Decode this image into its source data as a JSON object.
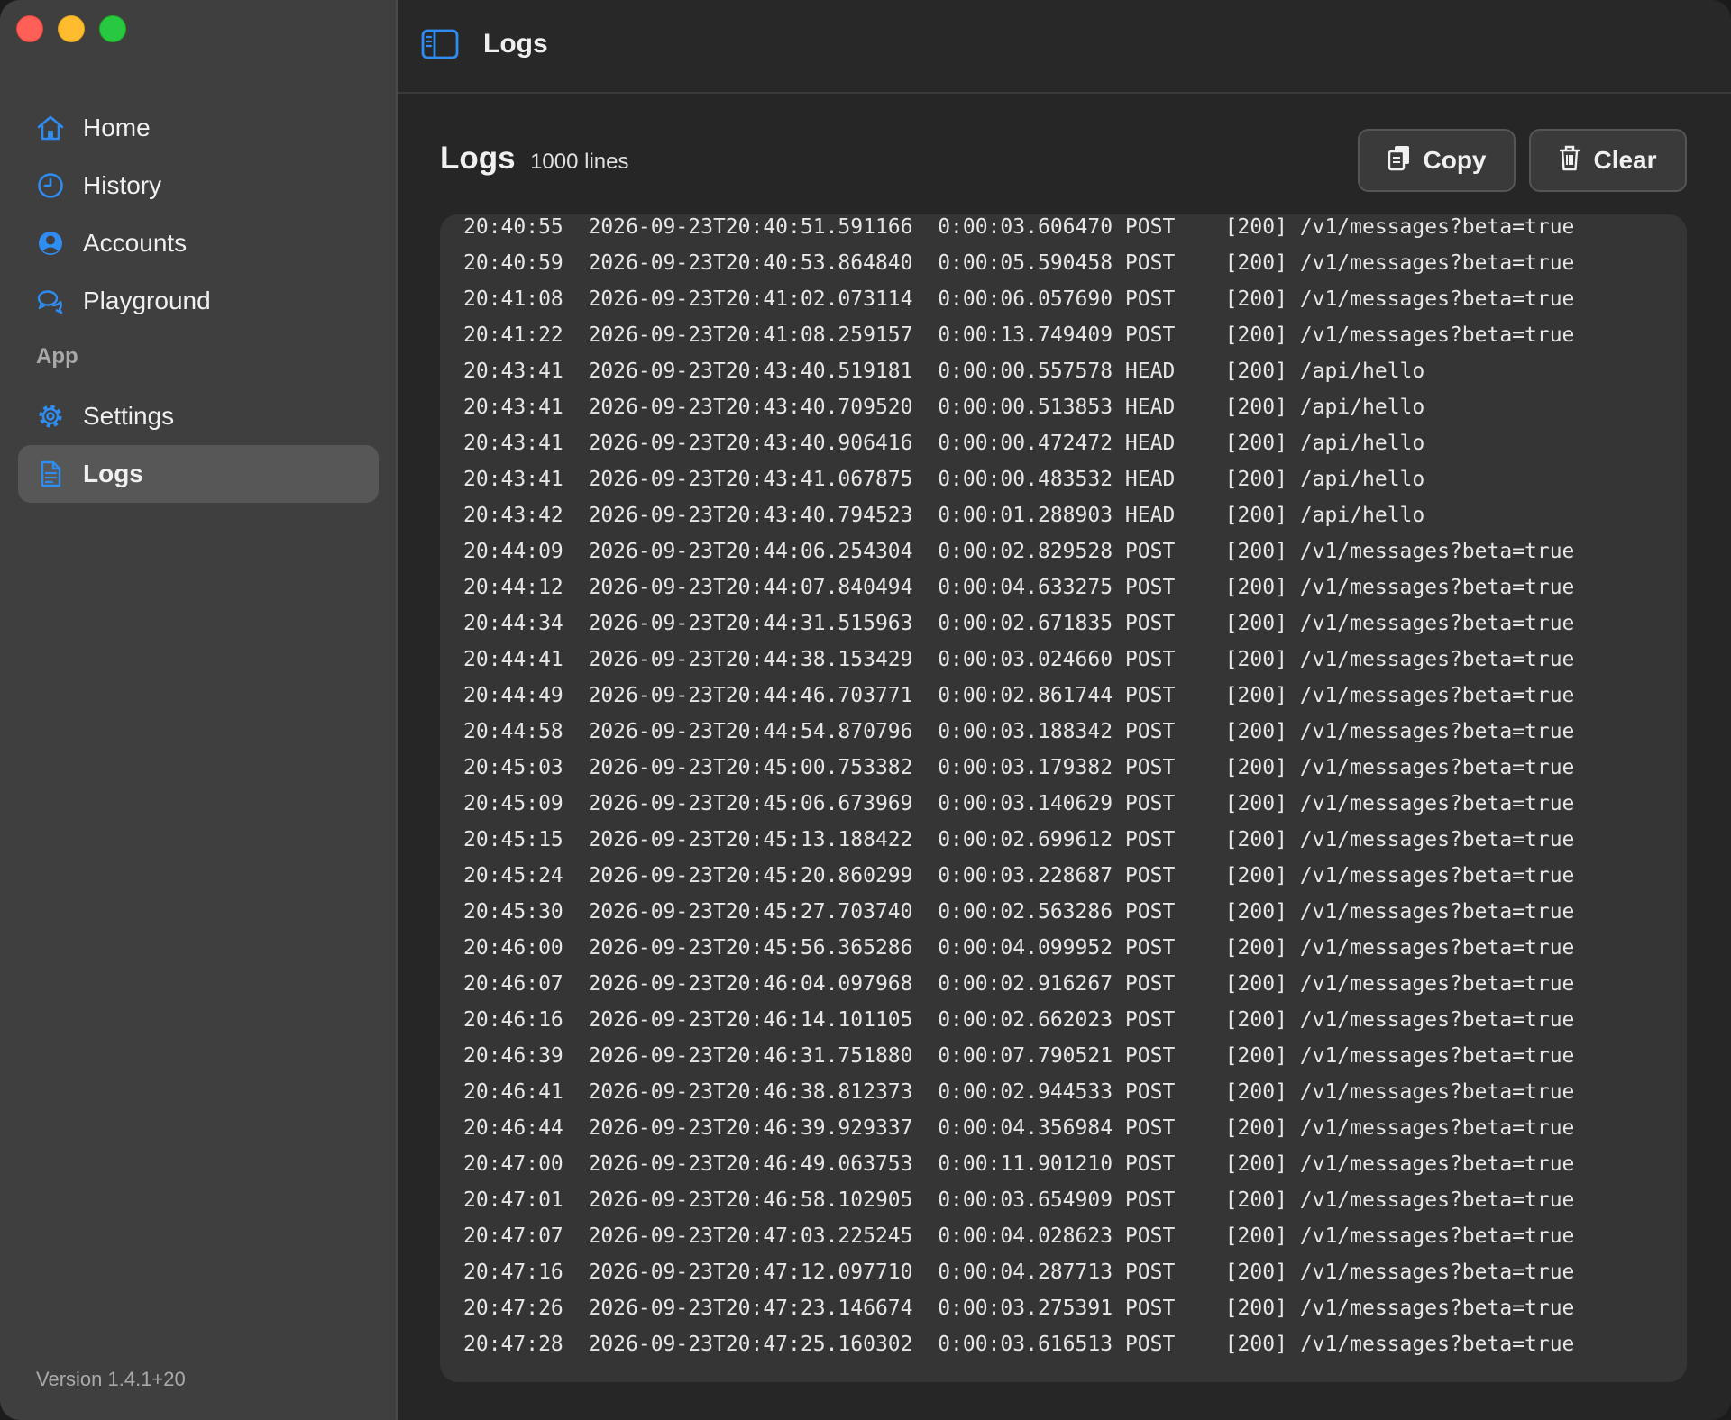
{
  "window": {
    "controls": [
      "close",
      "minimize",
      "zoom"
    ]
  },
  "sidebar": {
    "items": [
      {
        "label": "Home",
        "icon": "house-icon"
      },
      {
        "label": "History",
        "icon": "clock-icon"
      },
      {
        "label": "Accounts",
        "icon": "person-circle-icon"
      },
      {
        "label": "Playground",
        "icon": "chat-bubbles-icon"
      }
    ],
    "section_label": "App",
    "app_items": [
      {
        "label": "Settings",
        "icon": "gear-icon"
      },
      {
        "label": "Logs",
        "icon": "document-icon",
        "active": true
      }
    ],
    "version": "Version 1.4.1+20"
  },
  "toolbar": {
    "title": "Logs"
  },
  "logs": {
    "title": "Logs",
    "count": "1000 lines",
    "copy_label": "Copy",
    "clear_label": "Clear",
    "lines": [
      "20:40:55  2026-09-23T20:40:51.591166  0:00:03.606470 POST    [200] /v1/messages?beta=true",
      "20:40:59  2026-09-23T20:40:53.864840  0:00:05.590458 POST    [200] /v1/messages?beta=true",
      "20:41:08  2026-09-23T20:41:02.073114  0:00:06.057690 POST    [200] /v1/messages?beta=true",
      "20:41:22  2026-09-23T20:41:08.259157  0:00:13.749409 POST    [200] /v1/messages?beta=true",
      "20:43:41  2026-09-23T20:43:40.519181  0:00:00.557578 HEAD    [200] /api/hello",
      "20:43:41  2026-09-23T20:43:40.709520  0:00:00.513853 HEAD    [200] /api/hello",
      "20:43:41  2026-09-23T20:43:40.906416  0:00:00.472472 HEAD    [200] /api/hello",
      "20:43:41  2026-09-23T20:43:41.067875  0:00:00.483532 HEAD    [200] /api/hello",
      "20:43:42  2026-09-23T20:43:40.794523  0:00:01.288903 HEAD    [200] /api/hello",
      "20:44:09  2026-09-23T20:44:06.254304  0:00:02.829528 POST    [200] /v1/messages?beta=true",
      "20:44:12  2026-09-23T20:44:07.840494  0:00:04.633275 POST    [200] /v1/messages?beta=true",
      "20:44:34  2026-09-23T20:44:31.515963  0:00:02.671835 POST    [200] /v1/messages?beta=true",
      "20:44:41  2026-09-23T20:44:38.153429  0:00:03.024660 POST    [200] /v1/messages?beta=true",
      "20:44:49  2026-09-23T20:44:46.703771  0:00:02.861744 POST    [200] /v1/messages?beta=true",
      "20:44:58  2026-09-23T20:44:54.870796  0:00:03.188342 POST    [200] /v1/messages?beta=true",
      "20:45:03  2026-09-23T20:45:00.753382  0:00:03.179382 POST    [200] /v1/messages?beta=true",
      "20:45:09  2026-09-23T20:45:06.673969  0:00:03.140629 POST    [200] /v1/messages?beta=true",
      "20:45:15  2026-09-23T20:45:13.188422  0:00:02.699612 POST    [200] /v1/messages?beta=true",
      "20:45:24  2026-09-23T20:45:20.860299  0:00:03.228687 POST    [200] /v1/messages?beta=true",
      "20:45:30  2026-09-23T20:45:27.703740  0:00:02.563286 POST    [200] /v1/messages?beta=true",
      "20:46:00  2026-09-23T20:45:56.365286  0:00:04.099952 POST    [200] /v1/messages?beta=true",
      "20:46:07  2026-09-23T20:46:04.097968  0:00:02.916267 POST    [200] /v1/messages?beta=true",
      "20:46:16  2026-09-23T20:46:14.101105  0:00:02.662023 POST    [200] /v1/messages?beta=true",
      "20:46:39  2026-09-23T20:46:31.751880  0:00:07.790521 POST    [200] /v1/messages?beta=true",
      "20:46:41  2026-09-23T20:46:38.812373  0:00:02.944533 POST    [200] /v1/messages?beta=true",
      "20:46:44  2026-09-23T20:46:39.929337  0:00:04.356984 POST    [200] /v1/messages?beta=true",
      "20:47:00  2026-09-23T20:46:49.063753  0:00:11.901210 POST    [200] /v1/messages?beta=true",
      "20:47:01  2026-09-23T20:46:58.102905  0:00:03.654909 POST    [200] /v1/messages?beta=true",
      "20:47:07  2026-09-23T20:47:03.225245  0:00:04.028623 POST    [200] /v1/messages?beta=true",
      "20:47:16  2026-09-23T20:47:12.097710  0:00:04.287713 POST    [200] /v1/messages?beta=true",
      "20:47:26  2026-09-23T20:47:23.146674  0:00:03.275391 POST    [200] /v1/messages?beta=true",
      "20:47:28  2026-09-23T20:47:25.160302  0:00:03.616513 POST    [200] /v1/messages?beta=true"
    ]
  },
  "colors": {
    "accent": "#2f8cf0",
    "sidebar_bg": "#3f3f3f",
    "main_bg": "#262626",
    "log_bg": "#353535"
  }
}
